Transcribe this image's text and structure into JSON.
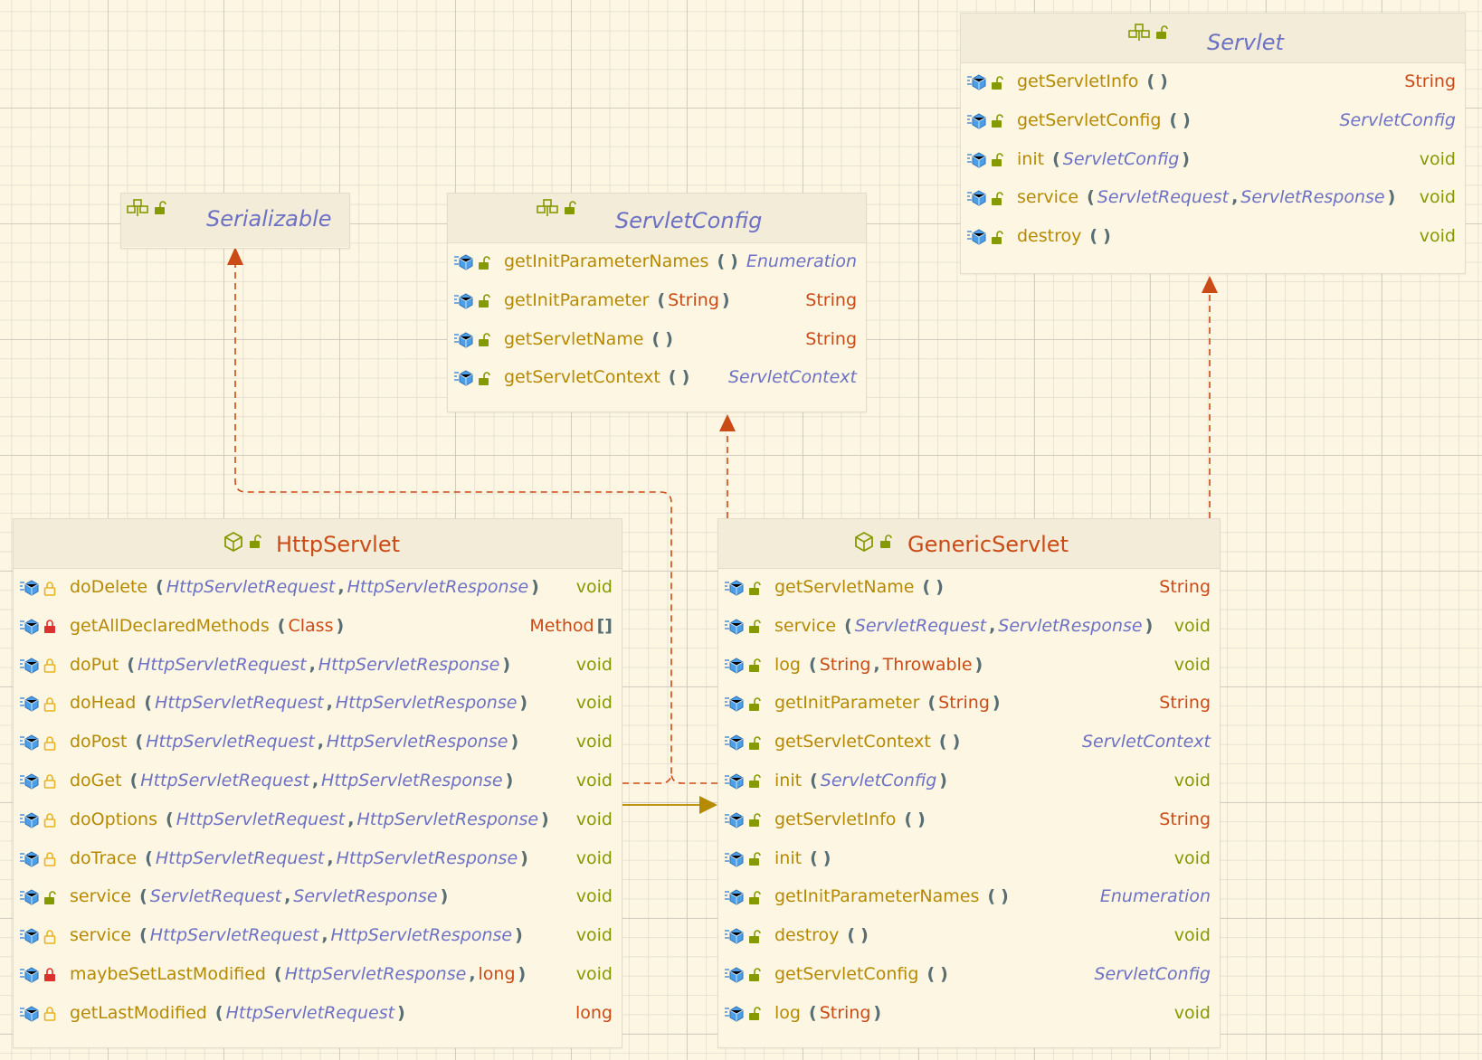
{
  "colors": {
    "background": "#fdf6e3",
    "method_name": "#b58900",
    "type_italic": "#6c71c4",
    "primitive": "#cb4b16",
    "void": "#859900",
    "class_title": "#cb4b16",
    "interface_title": "#6c71c4",
    "implements_arrow": "#cb4b16",
    "extends_arrow": "#b58900"
  },
  "icons": {
    "interface": "interface-icon",
    "class": "class-icon",
    "method": "method-icon",
    "public": "unlock-icon",
    "protected": "lock-icon",
    "private": "red-lock-icon"
  },
  "serializable": {
    "title": "Serializable"
  },
  "servlet_config": {
    "title": "ServletConfig",
    "methods": [
      {
        "name": "getInitParameterNames",
        "params": "()",
        "ret": "Enumeration"
      },
      {
        "name": "getInitParameter",
        "params": "(String)",
        "ret": "String"
      },
      {
        "name": "getServletName",
        "params": "()",
        "ret": "String"
      },
      {
        "name": "getServletContext",
        "params": "()",
        "ret": "ServletContext"
      }
    ]
  },
  "servlet": {
    "title": "Servlet",
    "methods": [
      {
        "name": "getServletInfo",
        "params": "()",
        "ret": "String"
      },
      {
        "name": "getServletConfig",
        "params": "()",
        "ret": "ServletConfig"
      },
      {
        "name": "init",
        "params": "(ServletConfig)",
        "ret": "void"
      },
      {
        "name": "service",
        "params": "(ServletRequest, ServletResponse)",
        "ret": "void"
      },
      {
        "name": "destroy",
        "params": "()",
        "ret": "void"
      }
    ]
  },
  "http_servlet": {
    "title": "HttpServlet",
    "methods": [
      {
        "name": "doDelete",
        "params": "(HttpServletRequest, HttpServletResponse)",
        "ret": "void",
        "access": "protected"
      },
      {
        "name": "getAllDeclaredMethods",
        "params": "(Class)",
        "ret": "Method[]",
        "access": "private"
      },
      {
        "name": "doPut",
        "params": "(HttpServletRequest, HttpServletResponse)",
        "ret": "void",
        "access": "protected"
      },
      {
        "name": "doHead",
        "params": "(HttpServletRequest, HttpServletResponse)",
        "ret": "void",
        "access": "protected"
      },
      {
        "name": "doPost",
        "params": "(HttpServletRequest, HttpServletResponse)",
        "ret": "void",
        "access": "protected"
      },
      {
        "name": "doGet",
        "params": "(HttpServletRequest, HttpServletResponse)",
        "ret": "void",
        "access": "protected"
      },
      {
        "name": "doOptions",
        "params": "(HttpServletRequest, HttpServletResponse)",
        "ret": "void",
        "access": "protected"
      },
      {
        "name": "doTrace",
        "params": "(HttpServletRequest, HttpServletResponse)",
        "ret": "void",
        "access": "protected"
      },
      {
        "name": "service",
        "params": "(ServletRequest, ServletResponse)",
        "ret": "void",
        "access": "public"
      },
      {
        "name": "service",
        "params": "(HttpServletRequest, HttpServletResponse)",
        "ret": "void",
        "access": "protected"
      },
      {
        "name": "maybeSetLastModified",
        "params": "(HttpServletResponse, long)",
        "ret": "void",
        "access": "private"
      },
      {
        "name": "getLastModified",
        "params": "(HttpServletRequest)",
        "ret": "long",
        "access": "protected"
      }
    ]
  },
  "generic_servlet": {
    "title": "GenericServlet",
    "methods": [
      {
        "name": "getServletName",
        "params": "()",
        "ret": "String"
      },
      {
        "name": "service",
        "params": "(ServletRequest, ServletResponse)",
        "ret": "void"
      },
      {
        "name": "log",
        "params": "(String, Throwable)",
        "ret": "void"
      },
      {
        "name": "getInitParameter",
        "params": "(String)",
        "ret": "String"
      },
      {
        "name": "getServletContext",
        "params": "()",
        "ret": "ServletContext"
      },
      {
        "name": "init",
        "params": "(ServletConfig)",
        "ret": "void"
      },
      {
        "name": "getServletInfo",
        "params": "()",
        "ret": "String"
      },
      {
        "name": "init",
        "params": "()",
        "ret": "void"
      },
      {
        "name": "getInitParameterNames",
        "params": "()",
        "ret": "Enumeration"
      },
      {
        "name": "destroy",
        "params": "()",
        "ret": "void"
      },
      {
        "name": "getServletConfig",
        "params": "()",
        "ret": "ServletConfig"
      },
      {
        "name": "log",
        "params": "(String)",
        "ret": "void"
      }
    ]
  }
}
